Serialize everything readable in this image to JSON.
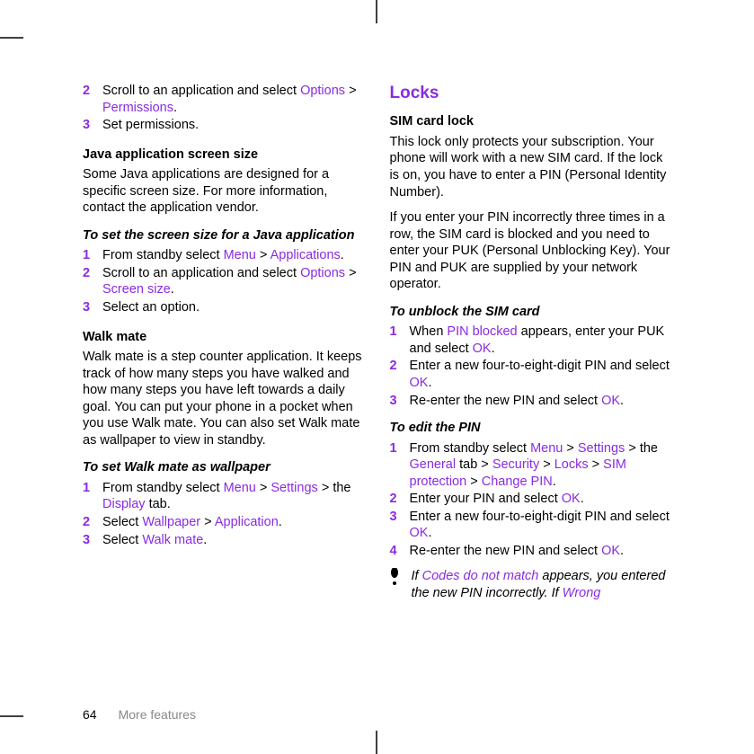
{
  "left": {
    "step2": {
      "num": "2",
      "t1": "Scroll to an application and select ",
      "opt": "Options",
      "gt": " > ",
      "perm": "Permissions",
      "dot": "."
    },
    "step3": {
      "num": "3",
      "text": "Set permissions."
    },
    "java_head": "Java application screen size",
    "java_para": "Some Java applications are designed for a specific screen size. For more information, contact the application vendor.",
    "java_to": "To set the screen size for a Java application",
    "j1": {
      "num": "1",
      "t1": "From standby select ",
      "menu": "Menu",
      "gt": " > ",
      "apps": "Applications",
      "dot": "."
    },
    "j2": {
      "num": "2",
      "t1": "Scroll to an application and select ",
      "opt": "Options",
      "gt": " > ",
      "ss": "Screen size",
      "dot": "."
    },
    "j3": {
      "num": "3",
      "text": "Select an option."
    },
    "walk_head": "Walk mate",
    "walk_para": "Walk mate is a step counter application. It keeps track of how many steps you have walked and how many steps you have left towards a daily goal. You can put your phone in a pocket when you use Walk mate. You can also set Walk mate as wallpaper to view in standby.",
    "walk_to": "To set Walk mate as wallpaper",
    "w1": {
      "num": "1",
      "t1": "From standby select ",
      "menu": "Menu",
      "gt": " > ",
      "settings": "Settings",
      "gt2": " > the ",
      "display": "Display",
      "t2": " tab."
    },
    "w2": {
      "num": "2",
      "t1": "Select ",
      "wp": "Wallpaper",
      "gt": " > ",
      "app": "Application",
      "dot": "."
    },
    "w3": {
      "num": "3",
      "t1": "Select ",
      "wm": "Walk mate",
      "dot": "."
    }
  },
  "right": {
    "locks": "Locks",
    "sim_head": "SIM card lock",
    "sim_p1": "This lock only protects your subscription. Your phone will work with a new SIM card. If the lock is on, you have to enter a PIN (Personal Identity Number).",
    "sim_p2": "If you enter your PIN incorrectly three times in a row, the SIM card is blocked and you need to enter your PUK (Personal Unblocking Key). Your PIN and PUK are supplied by your network operator.",
    "unblock_to": "To unblock the SIM card",
    "u1": {
      "num": "1",
      "t1": "When ",
      "pb": "PIN blocked",
      "t2": " appears, enter your PUK and select ",
      "ok": "OK",
      "dot": "."
    },
    "u2": {
      "num": "2",
      "t1": "Enter a new four-to-eight-digit PIN and select ",
      "ok": "OK",
      "dot": "."
    },
    "u3": {
      "num": "3",
      "t1": "Re-enter the new PIN and select ",
      "ok": "OK",
      "dot": "."
    },
    "edit_to": "To edit the PIN",
    "e1": {
      "num": "1",
      "t1": "From standby select ",
      "menu": "Menu",
      "gt": " > ",
      "settings": "Settings",
      "gt2": " > the ",
      "general": "General",
      "t2": " tab > ",
      "security": "Security",
      "gt3": " > ",
      "locks": "Locks",
      "gt4": " > ",
      "simp": "SIM protection",
      "gt5": " > ",
      "cp": "Change PIN",
      "dot": "."
    },
    "e2": {
      "num": "2",
      "t1": "Enter your PIN and select ",
      "ok": "OK",
      "dot": "."
    },
    "e3": {
      "num": "3",
      "t1": "Enter a new four-to-eight-digit PIN and select ",
      "ok": "OK",
      "dot": "."
    },
    "e4": {
      "num": "4",
      "t1": "Re-enter the new PIN and select ",
      "ok": "OK",
      "dot": "."
    },
    "note": {
      "t1": "If ",
      "cdm": "Codes do not match",
      "t2": " appears, you entered the new PIN incorrectly. If ",
      "wrong": "Wrong"
    }
  },
  "footer": {
    "page": "64",
    "section": "More features"
  }
}
